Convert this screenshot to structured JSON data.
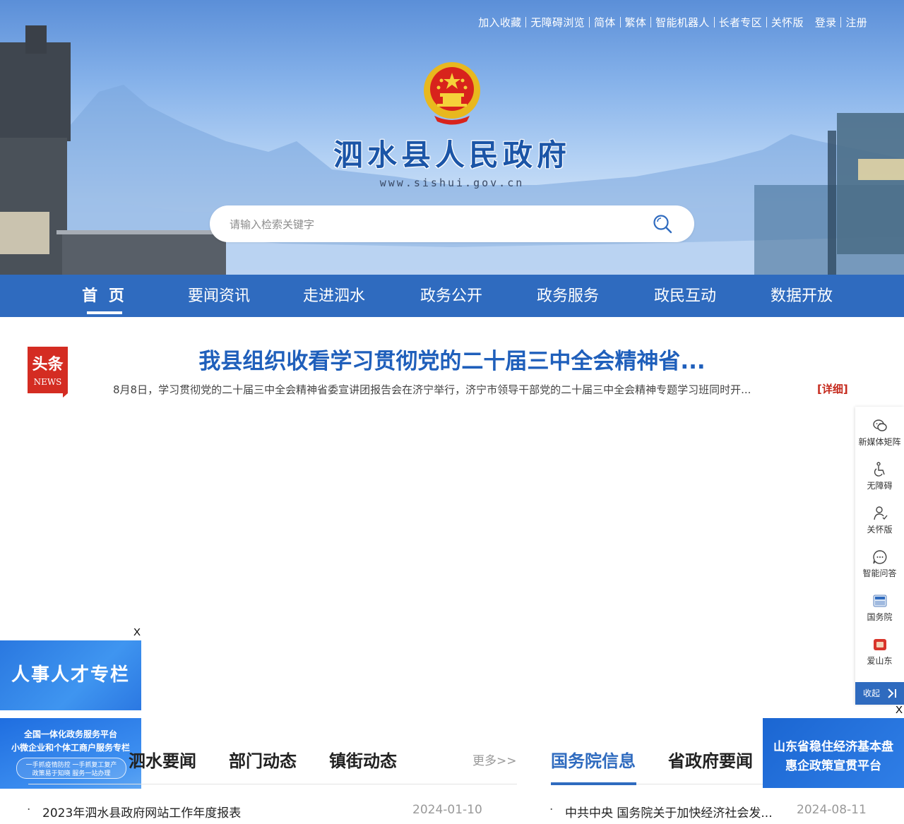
{
  "header": {
    "top_links": [
      "加入收藏",
      "无障碍浏览",
      "简体",
      "繁体",
      "智能机器人",
      "长者专区",
      "关怀版"
    ],
    "auth_links": [
      "登录",
      "注册"
    ],
    "site_title": "泗水县人民政府",
    "site_url": "www.sishui.gov.cn",
    "search_placeholder": "请输入检索关键字"
  },
  "nav": {
    "items": [
      "首 页",
      "要闻资讯",
      "走进泗水",
      "政务公开",
      "政务服务",
      "政民互动",
      "数据开放"
    ],
    "active": "首 页"
  },
  "headline": {
    "badge_top": "头条",
    "badge_bottom": "NEWS",
    "title": "我县组织收看学习贯彻党的二十届三中全会精神省...",
    "summary": "8月8日，学习贯彻党的二十届三中全会精神省委宣讲团报告会在济宁举行，济宁市领导干部党的二十届三中全会精神专题学习班同时开...",
    "detail_label": "[详细]"
  },
  "sidebar": {
    "items": [
      "新媒体矩阵",
      "无障碍",
      "关怀版",
      "智能问答",
      "国务院",
      "爱山东"
    ],
    "collapse_label": "收起"
  },
  "ads": {
    "close_label": "X",
    "talent_label": "人事人才专栏",
    "platform_line1": "全国一体化政务服务平台",
    "platform_line2": "小微企业和个体工商户服务专栏",
    "platform_pill1": "一手抓疫情防控 一手抓复工复产",
    "platform_pill2": "政策易于知晓 服务一站办理",
    "shandong_line1": "山东省稳住经济基本盘",
    "shandong_line2": "惠企政策宣贯平台"
  },
  "news_left": {
    "tabs": [
      "泗水要闻",
      "部门动态",
      "镇街动态"
    ],
    "more_label": "更多>>",
    "rows": [
      {
        "bullet": "·",
        "title": "2023年泗水县政府网站工作年度报表",
        "date": "2024-01-10"
      }
    ]
  },
  "news_right": {
    "tabs": [
      "国务院信息",
      "省政府要闻"
    ],
    "active": "国务院信息",
    "rows": [
      {
        "bullet": "·",
        "title": "中共中央 国务院关于加快经济社会发...",
        "date": "2024-08-11"
      }
    ]
  },
  "colors": {
    "primary_blue": "#2f6bbf",
    "title_blue": "#1b55a7",
    "headline_blue": "#1f5fbb",
    "detail_red": "#c52a1d",
    "badge_red": "#d42c22"
  }
}
